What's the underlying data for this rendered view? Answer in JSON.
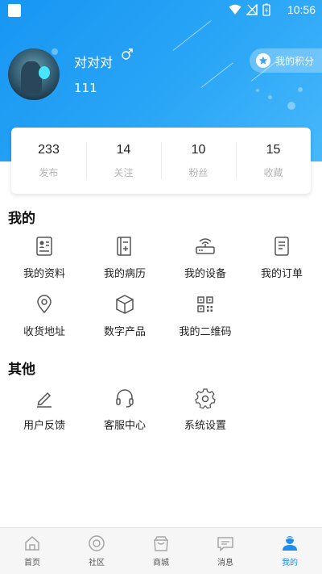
{
  "status_bar": {
    "time": "10:56"
  },
  "profile": {
    "username": "对对对",
    "user_id": "111",
    "points_label": "我的积分"
  },
  "stats": [
    {
      "value": "233",
      "label": "发布"
    },
    {
      "value": "14",
      "label": "关注"
    },
    {
      "value": "10",
      "label": "粉丝"
    },
    {
      "value": "15",
      "label": "收藏"
    }
  ],
  "my_section": {
    "title": "我的",
    "items": [
      {
        "label": "我的资料",
        "icon": "profile-card-icon"
      },
      {
        "label": "我的病历",
        "icon": "medical-record-icon"
      },
      {
        "label": "我的设备",
        "icon": "router-device-icon"
      },
      {
        "label": "我的订单",
        "icon": "order-document-icon"
      },
      {
        "label": "收货地址",
        "icon": "location-pin-icon"
      },
      {
        "label": "数字产品",
        "icon": "cube-icon"
      },
      {
        "label": "我的二维码",
        "icon": "qr-code-icon"
      }
    ]
  },
  "other_section": {
    "title": "其他",
    "items": [
      {
        "label": "用户反馈",
        "icon": "pencil-icon"
      },
      {
        "label": "客服中心",
        "icon": "headset-icon"
      },
      {
        "label": "系统设置",
        "icon": "gear-icon"
      }
    ]
  },
  "bottom_nav": {
    "items": [
      {
        "label": "首页",
        "icon": "home-icon"
      },
      {
        "label": "社区",
        "icon": "community-icon"
      },
      {
        "label": "商城",
        "icon": "shopping-bag-icon"
      },
      {
        "label": "消息",
        "icon": "message-icon"
      },
      {
        "label": "我的",
        "icon": "user-icon"
      }
    ],
    "active_index": 4
  },
  "colors": {
    "primary": "#1b8ef2",
    "icon_gray": "#555555",
    "nav_gray": "#a5a5a5"
  }
}
